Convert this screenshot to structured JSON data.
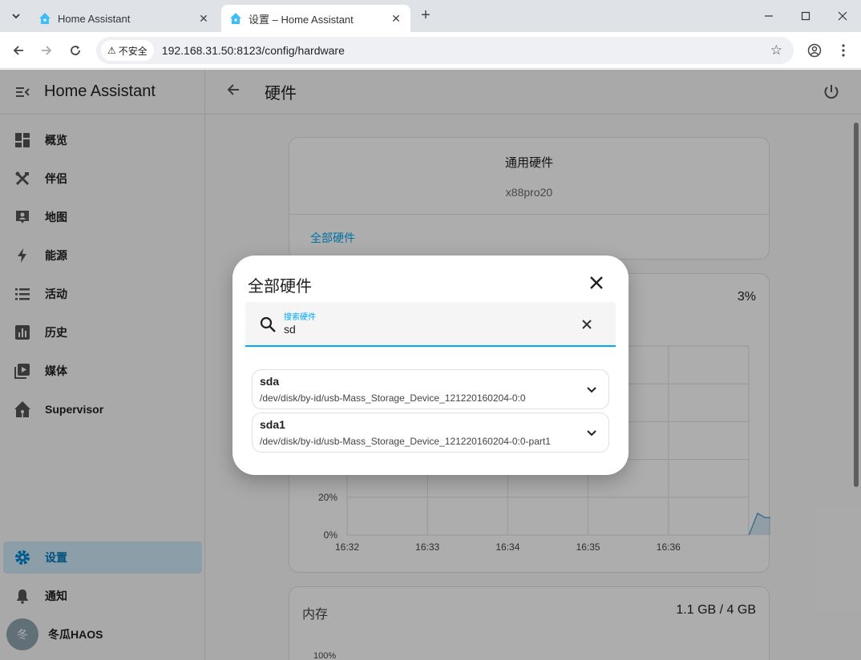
{
  "browser": {
    "tabs": [
      {
        "title": "Home Assistant",
        "active": false
      },
      {
        "title": "设置 – Home Assistant",
        "active": true
      }
    ],
    "security_label": "不安全",
    "url": "192.168.31.50:8123/config/hardware"
  },
  "sidebar": {
    "title": "Home Assistant",
    "items": [
      {
        "label": "概览",
        "icon": "dashboard-icon"
      },
      {
        "label": "伴侣",
        "icon": "tools-icon"
      },
      {
        "label": "地图",
        "icon": "map-person-icon"
      },
      {
        "label": "能源",
        "icon": "lightning-icon"
      },
      {
        "label": "活动",
        "icon": "list-icon"
      },
      {
        "label": "历史",
        "icon": "chart-box-icon"
      },
      {
        "label": "媒体",
        "icon": "play-box-icon"
      },
      {
        "label": "Supervisor",
        "icon": "home-assistant-icon"
      }
    ],
    "settings_label": "设置",
    "notifications_label": "通知",
    "user": {
      "initial": "冬",
      "name": "冬瓜HAOS"
    }
  },
  "header": {
    "title": "硬件"
  },
  "board_card": {
    "title": "通用硬件",
    "subtitle": "x88pro20",
    "link": "全部硬件"
  },
  "processor_card": {
    "percent": "3%",
    "chart_data": {
      "type": "area",
      "x_ticks": [
        "16:32",
        "16:33",
        "16:34",
        "16:35",
        "16:36"
      ],
      "y_ticks_visible": [
        "20%",
        "0%"
      ],
      "ylim": [
        0,
        100
      ],
      "series": [
        {
          "x": [
            16.6167,
            16.6185,
            16.62,
            16.622,
            16.6245,
            16.626,
            16.627
          ],
          "y": [
            0,
            5,
            4,
            4,
            4,
            5,
            3
          ]
        }
      ]
    }
  },
  "memory_card": {
    "title": "内存",
    "value": "1.1 GB / 4 GB",
    "first_tick": "100%"
  },
  "dialog": {
    "title": "全部硬件",
    "search_label": "搜索硬件",
    "search_value": "sd",
    "devices": [
      {
        "name": "sda",
        "path": "/dev/disk/by-id/usb-Mass_Storage_Device_121220160204-0:0"
      },
      {
        "name": "sda1",
        "path": "/dev/disk/by-id/usb-Mass_Storage_Device_121220160204-0:0-part1"
      }
    ]
  },
  "colors": {
    "accent": "#03a9f4",
    "series": "#5aa9d6"
  }
}
